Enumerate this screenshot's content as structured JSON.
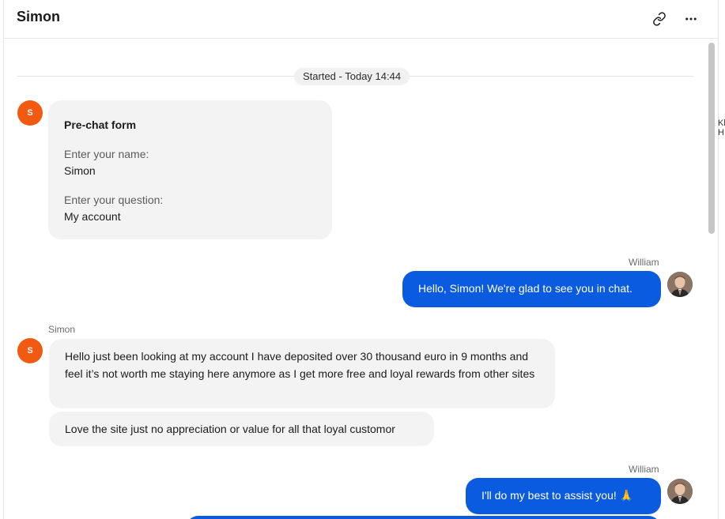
{
  "header": {
    "title": "Simon",
    "link_icon": "link-icon",
    "more_icon": "more-horizontal-icon"
  },
  "timeline": {
    "started_label": "Started - Today 14:44"
  },
  "prechat_form": {
    "title": "Pre-chat form",
    "name_label": "Enter your name:",
    "name_value": "Simon",
    "question_label": "Enter your question:",
    "question_value": "My account"
  },
  "avatars": {
    "customer_initial": "S"
  },
  "messages": [
    {
      "sender": "William",
      "text": "Hello, Simon! We're glad to see you in chat."
    },
    {
      "sender": "Simon",
      "text": "Hello just been looking at my account I have deposited over 30 thousand euro in 9 months and feel it’s not worth me staying here anymore as I get more free and loyal rewards from other sites"
    },
    {
      "sender": "",
      "text": "Love the site just no appreciation or value for all that loyal customor"
    },
    {
      "sender": "William",
      "text": "I'll do my best to assist you! 🙏"
    }
  ],
  "side_strip_text": "Kl H",
  "colors": {
    "agent_bubble": "#0a5be0",
    "customer_avatar": "#f25a12",
    "user_bubble": "#f3f3f3"
  }
}
